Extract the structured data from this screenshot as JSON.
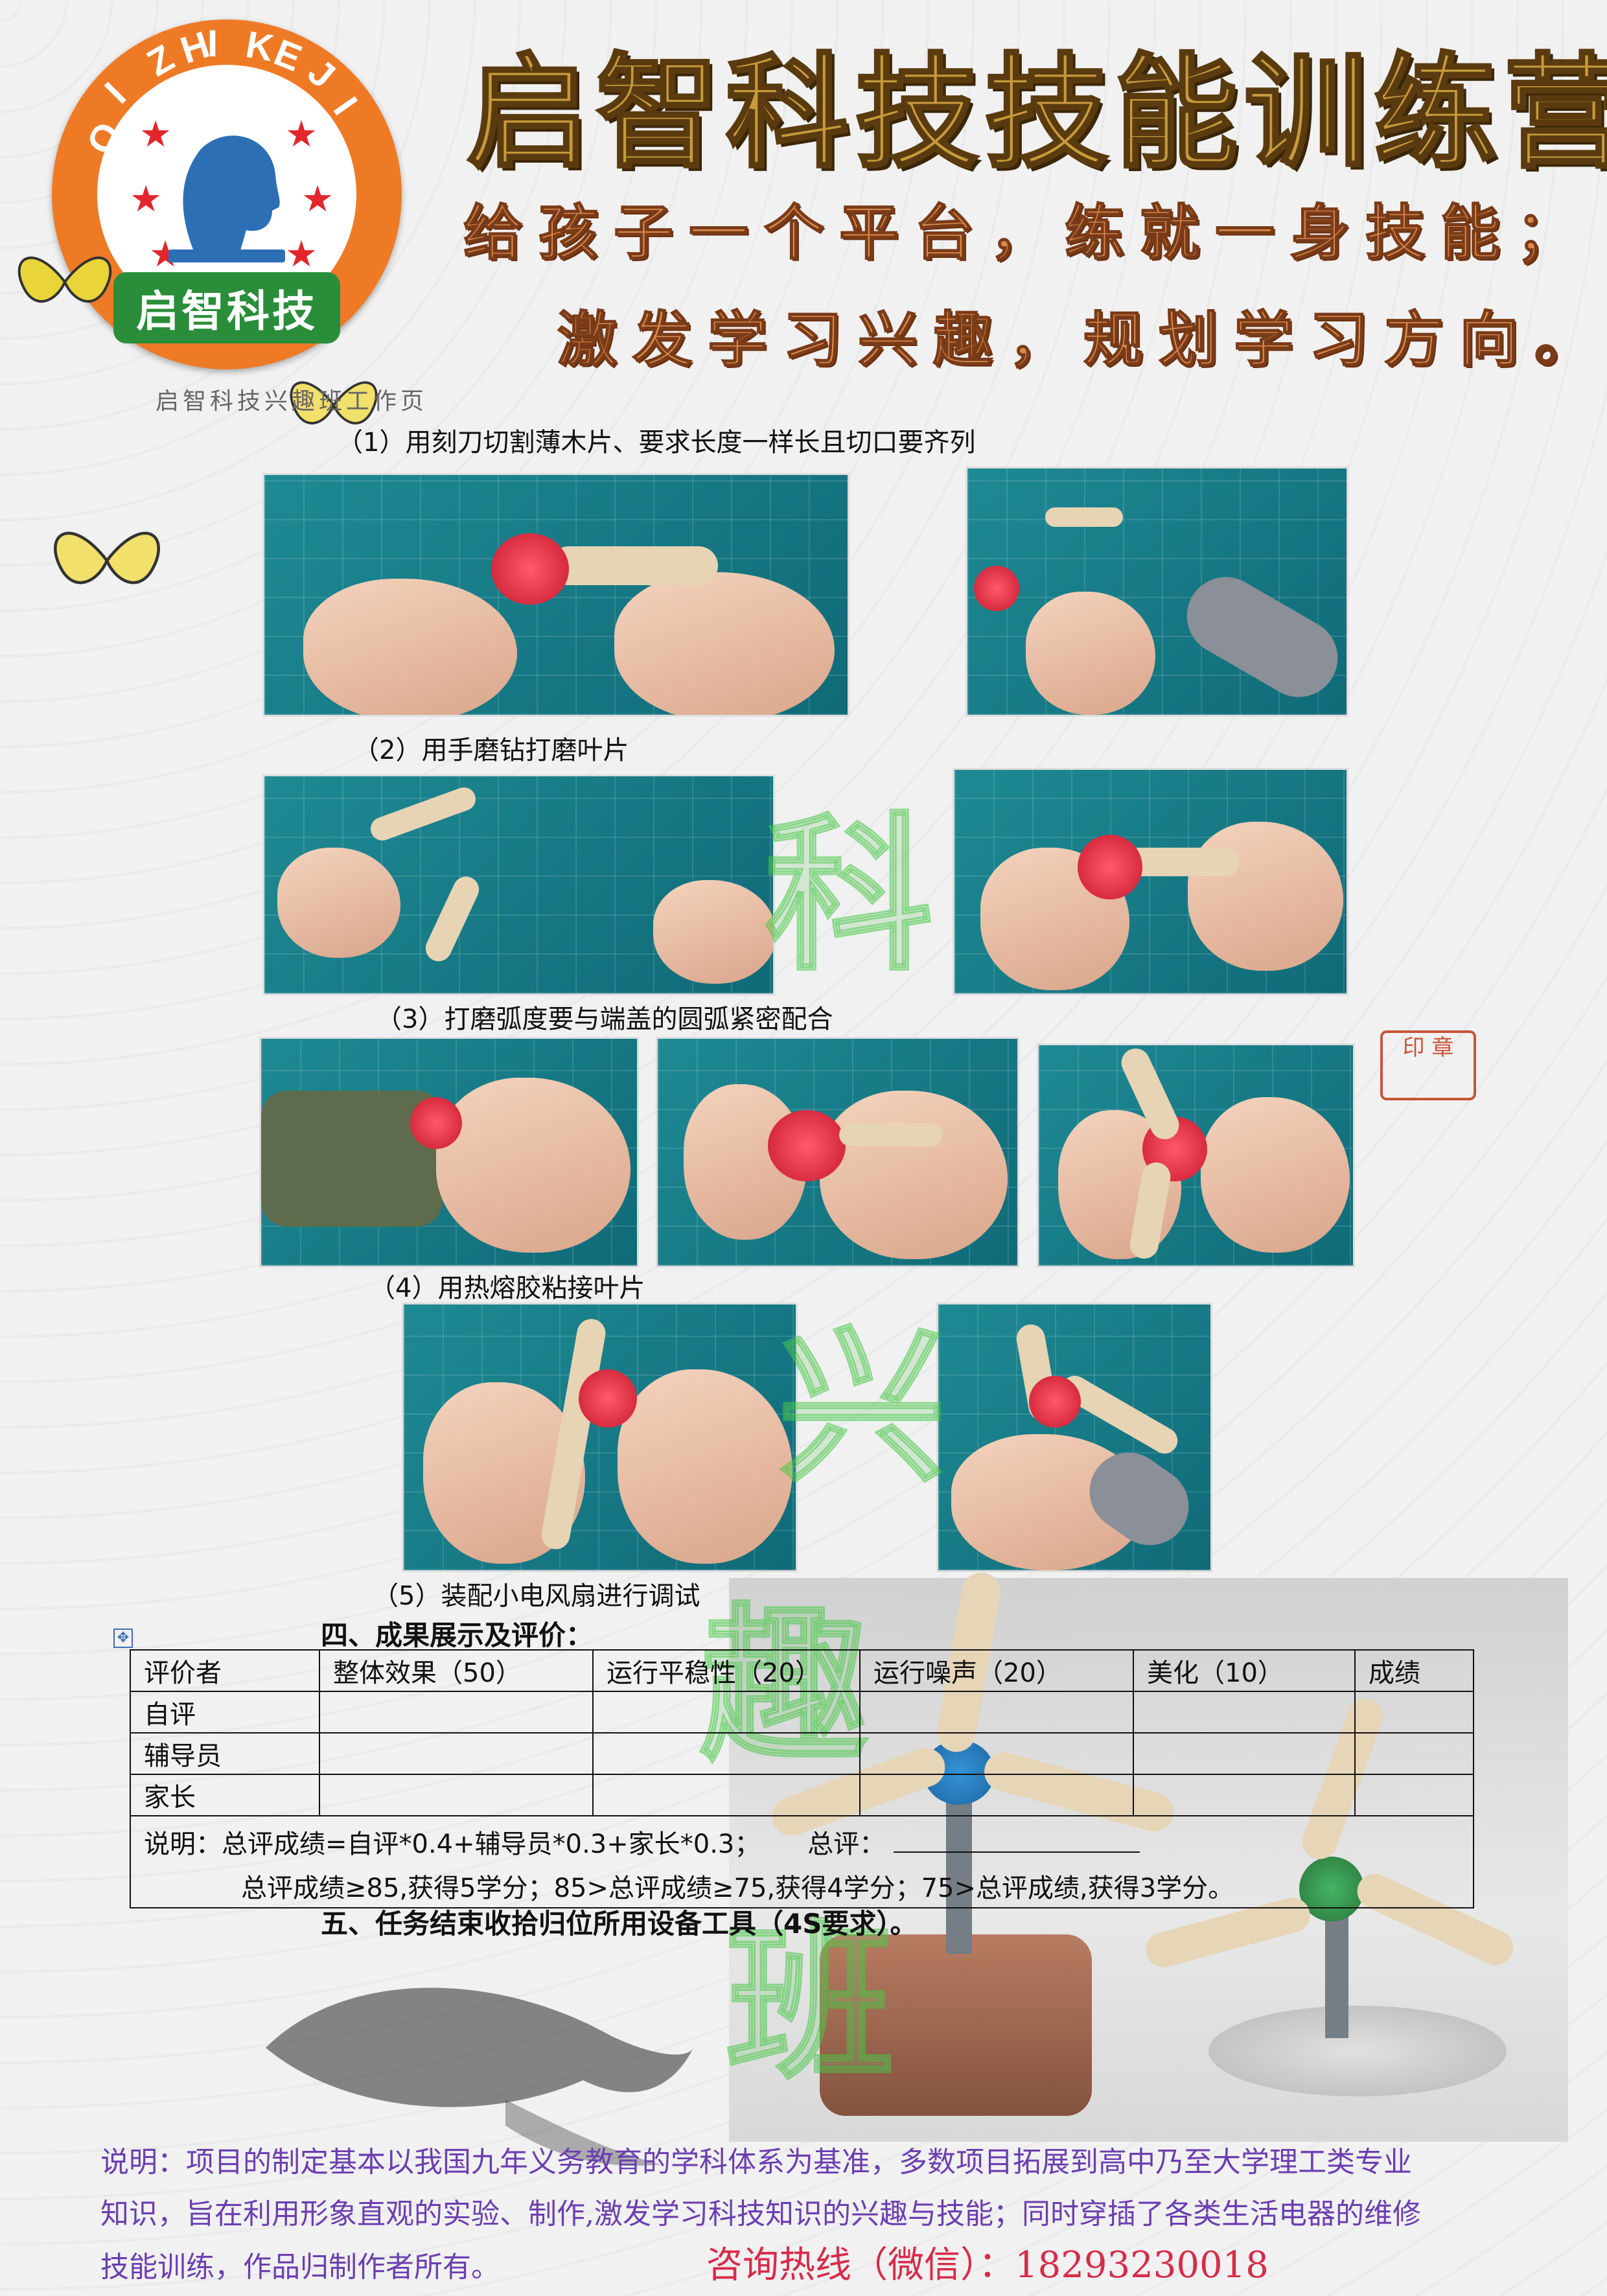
{
  "header": {
    "logo_ring_text": "QI ZHI KE JI",
    "logo_name": "启智科技",
    "title": "启智科技技能训练营",
    "slogan_1": "给孩子一个平台，练就一身技能；",
    "slogan_2": "激发学习兴趣，规划学习方向。"
  },
  "page_header": "启智科技兴趣班工作页",
  "steps": {
    "s1": "（1）用刻刀切割薄木片、要求长度一样长且切口要齐列",
    "s2": "（2）用手磨钻打磨叶片",
    "s3": "（3）打磨弧度要与端盖的圆弧紧密配合",
    "s4": "（4）用热熔胶粘接叶片",
    "s5": "（5）装配小电风扇进行调试"
  },
  "section4": "四、成果展示及评价：",
  "table": {
    "headers": [
      "评价者",
      "整体效果（50）",
      "运行平稳性（20）",
      "运行噪声（20）",
      "美化（10）",
      "成绩"
    ],
    "rows": [
      "自评",
      "辅导员",
      "家长"
    ],
    "note_1": "说明：总评成绩=自评*0.4+辅导员*0.3+家长*0.3；",
    "total_label": "总评：",
    "note_2": "总评成绩≥85,获得5学分；85>总评成绩≥75,获得4学分；75>总评成绩,获得3学分。"
  },
  "section5": "五、任务结束收拾归位所用设备工具（4S要求）。",
  "footer": {
    "line1": "说明：项目的制定基本以我国九年义务教育的学科体系为基准，多数项目拓展到高中乃至大学理工类专业",
    "line2": "知识，旨在利用形象直观的实验、制作,激发学习科技知识的兴趣与技能；同时穿插了各类生活电器的维修",
    "line3": "技能训练，作品归制作者所有。",
    "hotline": "咨询热线（微信）：18293230018"
  },
  "watermark": [
    "科",
    "兴",
    "趣",
    "班"
  ],
  "colors": {
    "logo_orange": "#ef7a26",
    "title_gold": "#c69a3b",
    "footer_purple": "#6b3fb0",
    "hotline_red": "#d72b4a"
  }
}
